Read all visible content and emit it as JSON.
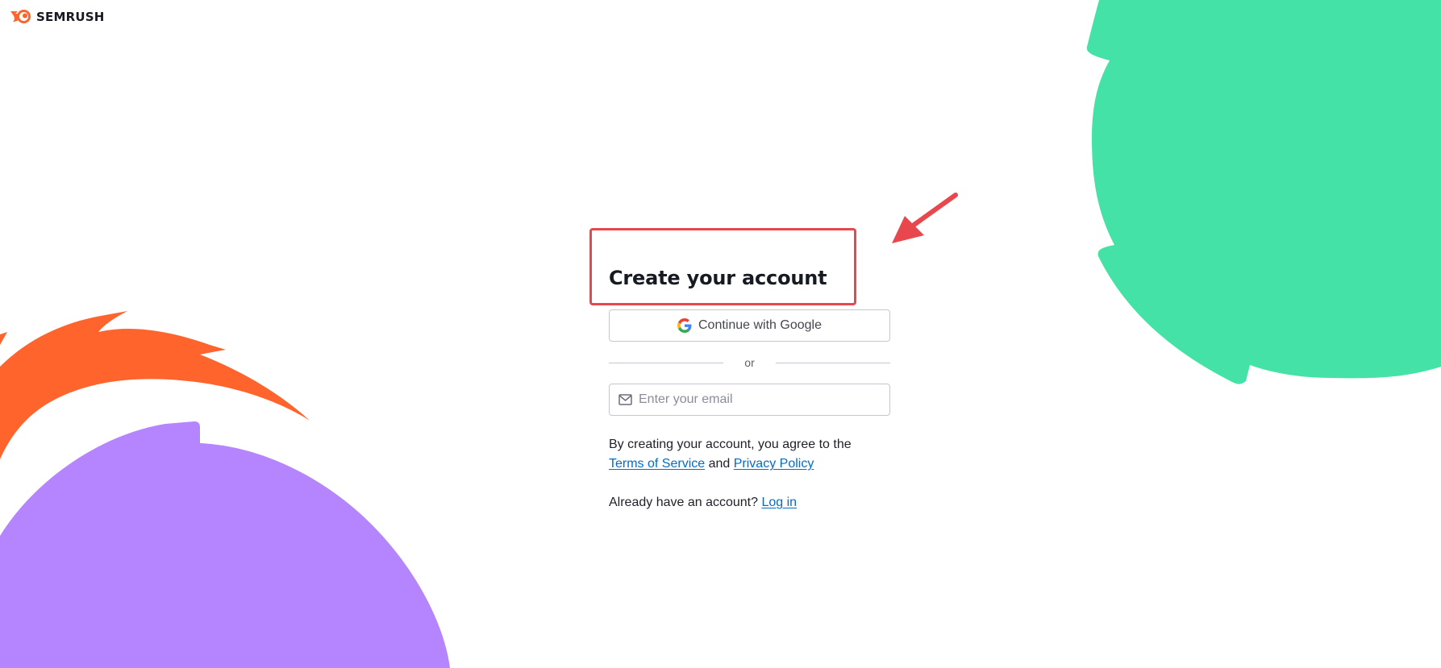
{
  "brand": {
    "name": "SEMRUSH",
    "logo_icon": "semrush-flame-icon",
    "color": "#ff642d"
  },
  "signup": {
    "title": "Create your account",
    "google_button_label": "Continue with Google",
    "divider_text": "or",
    "email_placeholder": "Enter your email",
    "email_value": "",
    "legal_prefix": "By creating your account, you agree to the",
    "terms_link": "Terms of Service",
    "legal_and": "and",
    "privacy_link": "Privacy Policy",
    "login_prompt": "Already have an account?",
    "login_link": "Log in"
  },
  "icons": {
    "google": "google-g-icon",
    "email": "mail-icon"
  },
  "colors": {
    "link": "#006dca",
    "annotation": "#e8484d",
    "shape_green": "#45e2a8",
    "shape_orange": "#ff642d",
    "shape_purple": "#b584ff"
  }
}
